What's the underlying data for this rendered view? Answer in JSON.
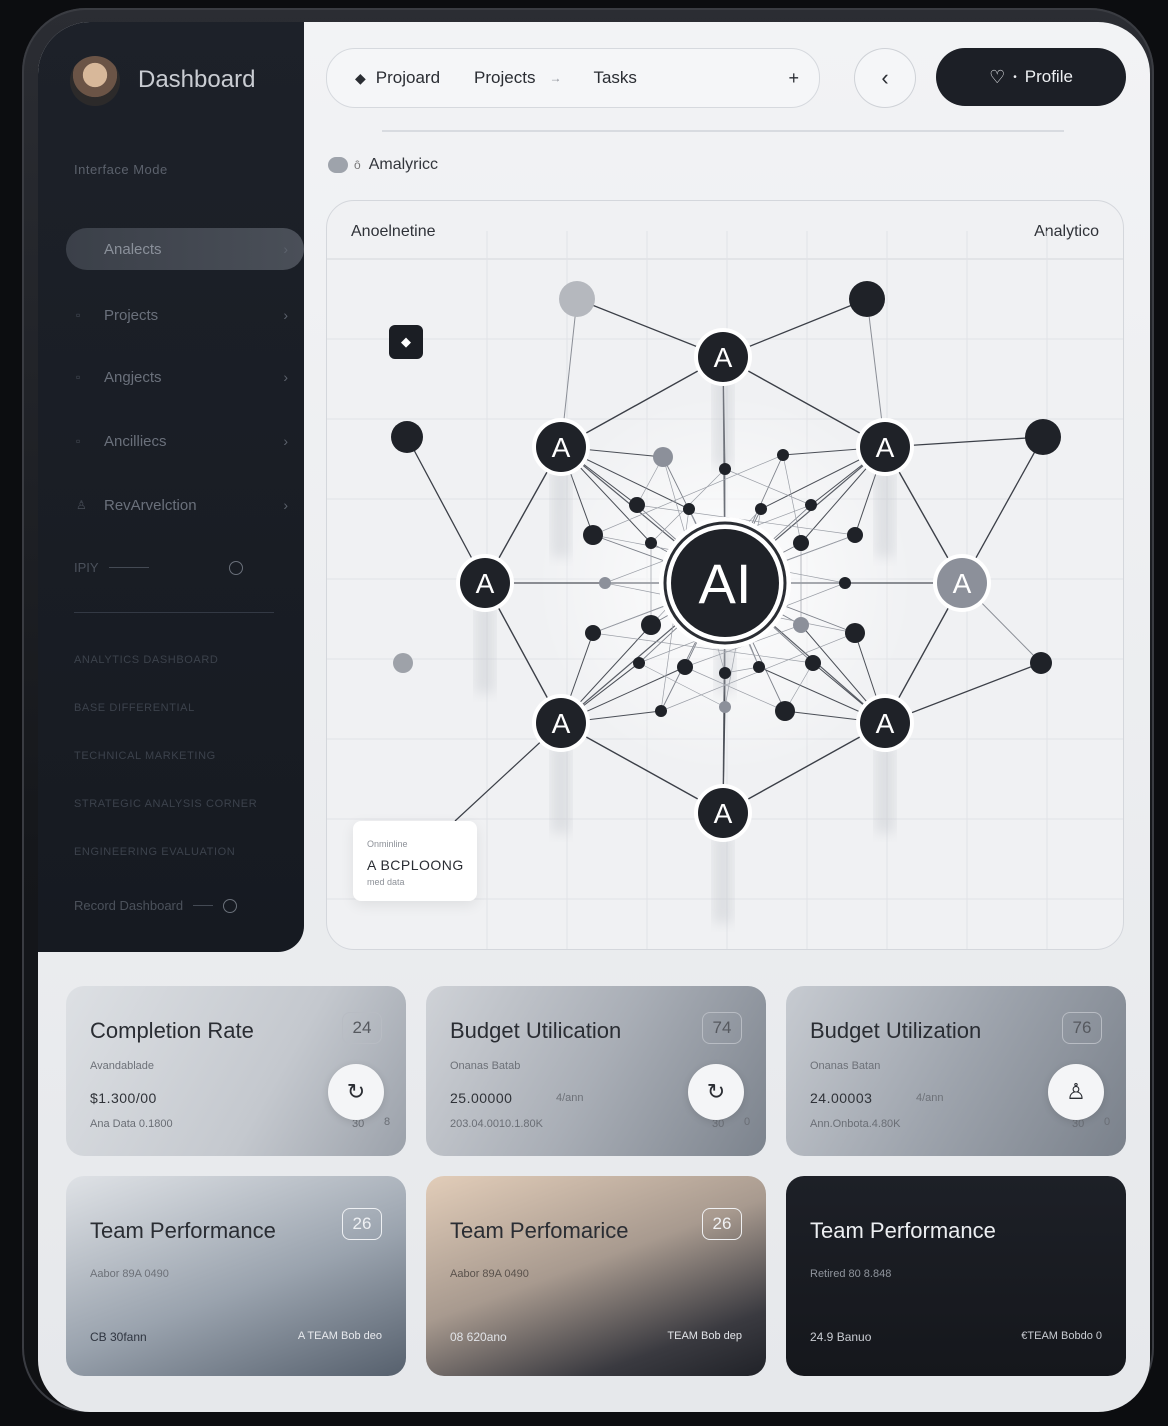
{
  "sidebar": {
    "title": "Dashboard",
    "subtitle": "Interface Mode",
    "items": [
      {
        "label": "Analects",
        "active": true
      },
      {
        "label": "Projects",
        "active": false
      },
      {
        "label": "Angjects",
        "active": false
      },
      {
        "label": "Ancilliecs",
        "active": false
      },
      {
        "label": "RevArvelction",
        "active": false
      }
    ],
    "setting_label": "IPIY",
    "lines": [
      "ANALYTICS DASHBOARD",
      "BASE DIFFERENTIAL",
      "TECHNICAL MARKETING",
      "STRATEGIC ANALYSIS CORNER",
      "ENGINEERING EVALUATION"
    ],
    "footer_label": "Record Dashboard"
  },
  "topbar": {
    "item1": "Projoard",
    "item2": "Projects",
    "item3": "Tasks",
    "plus": "+",
    "back": "‹",
    "profile": "Profile"
  },
  "section_title": "Amalyricc",
  "panel": {
    "header_left": "Anoelnetine",
    "header_right": "Analytico",
    "center_label": "AI",
    "node_label": "A",
    "tag_label": "◆",
    "legend_line1": "Onminline",
    "legend_line2": "A BCPLOONG",
    "legend_line3": "med data"
  },
  "cards": [
    {
      "title": "Completion Rate",
      "badge": "24",
      "sub": "Avandablade",
      "value": "$1.300/00",
      "value_extra": "",
      "foot": "Ana Data 0.1800",
      "num1": "30",
      "num2": "8",
      "icon": "↻"
    },
    {
      "title": "Budget Utilication",
      "badge": "74",
      "sub": "Onanas Batab",
      "value": "25.00000",
      "value_extra": "4/ann",
      "foot": "203.04.0010.1.80K",
      "num1": "30",
      "num2": "0",
      "icon": "↻"
    },
    {
      "title": "Budget Utilization",
      "badge": "76",
      "sub": "Onanas Batan",
      "value": "24.00003",
      "value_extra": "4/ann",
      "foot": "Ann.Onbota.4.80K",
      "num1": "30",
      "num2": "0",
      "icon": "♙"
    },
    {
      "title": "Team Performance",
      "badge": "26",
      "sub": "Aabor 89A 0490",
      "left": "CB 30fann",
      "right": "A TEAM Bob deo"
    },
    {
      "title": "Team Perfomarice",
      "badge": "26",
      "sub": "Aabor 89A 0490",
      "left": "08 620ano",
      "right": "TEAM Bob dep"
    },
    {
      "title": "Team Performance",
      "badge": "",
      "sub": "Retired 80 8.848",
      "left": "24.9 Banuo",
      "right": "€TEAM Bobdo 0"
    }
  ],
  "colors": {
    "sidebar": "#1d2129",
    "accent_dark": "#1c1f26",
    "node_dark": "#1f2228",
    "node_gray": "#8c909a"
  }
}
